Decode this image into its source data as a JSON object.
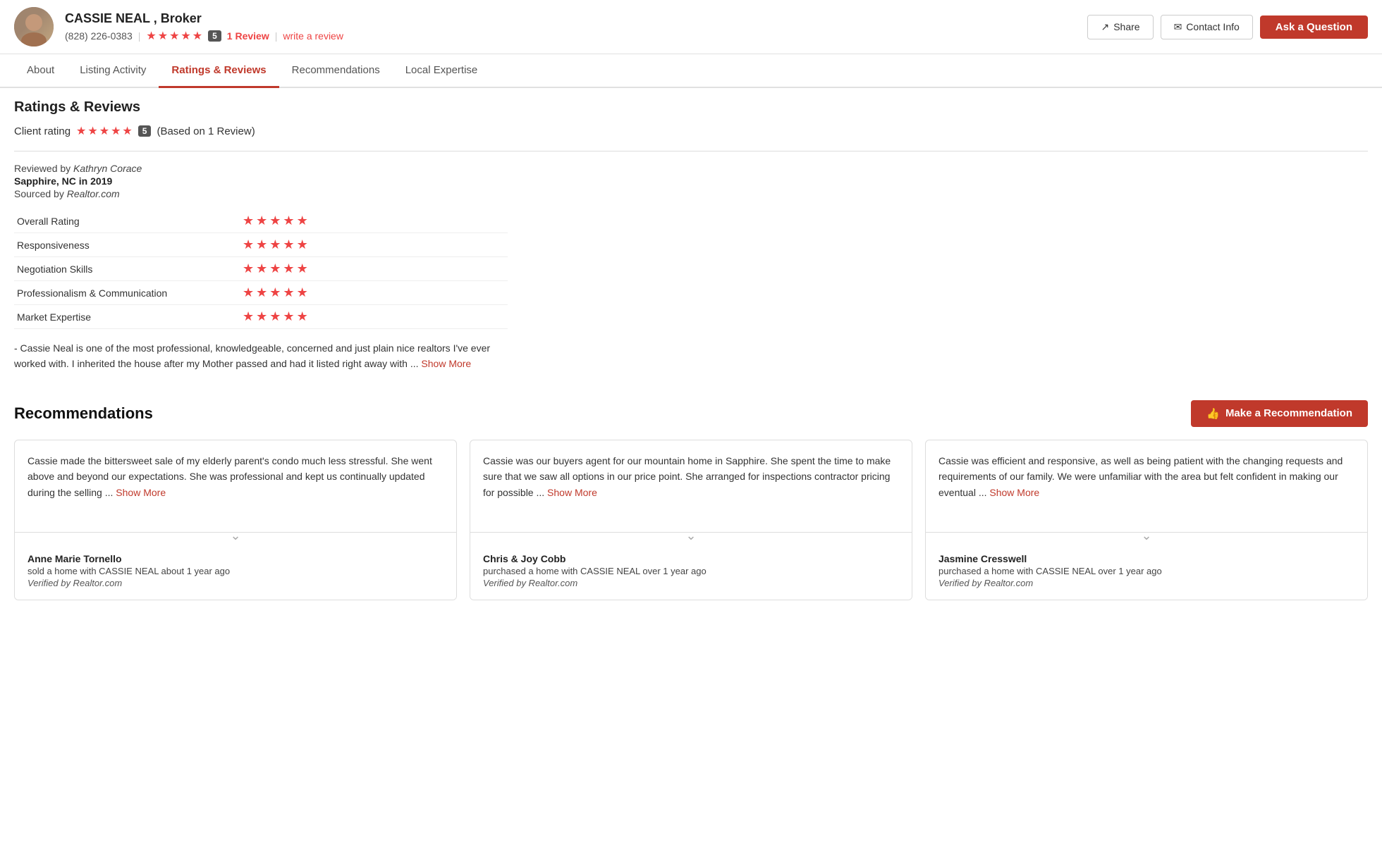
{
  "header": {
    "agent_name": "CASSIE NEAL , Broker",
    "phone": "(828) 226-0383",
    "star_count": 5,
    "star_badge": "5",
    "review_count": "1 Review",
    "write_review": "write a review",
    "share_label": "Share",
    "contact_info_label": "Contact Info",
    "ask_question_label": "Ask a Question"
  },
  "nav": {
    "tabs": [
      {
        "id": "about",
        "label": "About",
        "active": false
      },
      {
        "id": "listing",
        "label": "Listing Activity",
        "active": false
      },
      {
        "id": "ratings",
        "label": "Ratings & Reviews",
        "active": true
      },
      {
        "id": "recommendations",
        "label": "Recommendations",
        "active": false
      },
      {
        "id": "expertise",
        "label": "Local Expertise",
        "active": false
      }
    ]
  },
  "ratings_section": {
    "title": "Ratings & Reviews",
    "client_rating_label": "Client rating",
    "star_badge": "5",
    "based_on": "(Based on 1 Review)",
    "review": {
      "reviewed_by_label": "Reviewed by",
      "reviewer_name": "Kathryn Corace",
      "location": "Sapphire, NC in 2019",
      "sourced_label": "Sourced by",
      "sourced_by": "Realtor.com",
      "ratings": [
        {
          "category": "Overall Rating",
          "stars": 5
        },
        {
          "category": "Responsiveness",
          "stars": 5
        },
        {
          "category": "Negotiation Skills",
          "stars": 5
        },
        {
          "category": "Professionalism & Communication",
          "stars": 5
        },
        {
          "category": "Market Expertise",
          "stars": 5
        }
      ],
      "review_text": "- Cassie Neal is one of the most professional, knowledgeable, concerned and just plain nice realtors I've ever worked with. I inherited the house after my Mother passed and had it listed right away with ...",
      "show_more_label": "Show More"
    }
  },
  "recommendations_section": {
    "title": "Recommendations",
    "make_rec_label": "Make a Recommendation",
    "cards": [
      {
        "body": "Cassie made the bittersweet sale of my elderly parent's condo much less stressful. She went above and beyond our expectations. She was professional and kept us continually updated during the selling ...",
        "show_more": "Show More",
        "name": "Anne Marie Tornello",
        "detail": "sold a home with CASSIE NEAL about 1 year ago",
        "verified": "Verified by Realtor.com"
      },
      {
        "body": "Cassie was our buyers agent for our mountain home in Sapphire. She spent the time to make sure that we saw all options in our price point. She arranged for inspections contractor pricing for possible ...",
        "show_more": "Show More",
        "name": "Chris & Joy Cobb",
        "detail": "purchased a home with CASSIE NEAL over 1 year ago",
        "verified": "Verified by Realtor.com"
      },
      {
        "body": "Cassie was efficient and responsive, as well as being patient with the changing requests and requirements of our family. We were unfamiliar with the area but felt confident in making our eventual ...",
        "show_more": "Show More",
        "name": "Jasmine Cresswell",
        "detail": "purchased a home with CASSIE NEAL over 1 year ago",
        "verified": "Verified by Realtor.com"
      }
    ],
    "show_more_ratings": "Show More",
    "show_more_recs": "Show More"
  },
  "icons": {
    "share": "↗",
    "email": "✉",
    "thumbs_up": "👍"
  }
}
